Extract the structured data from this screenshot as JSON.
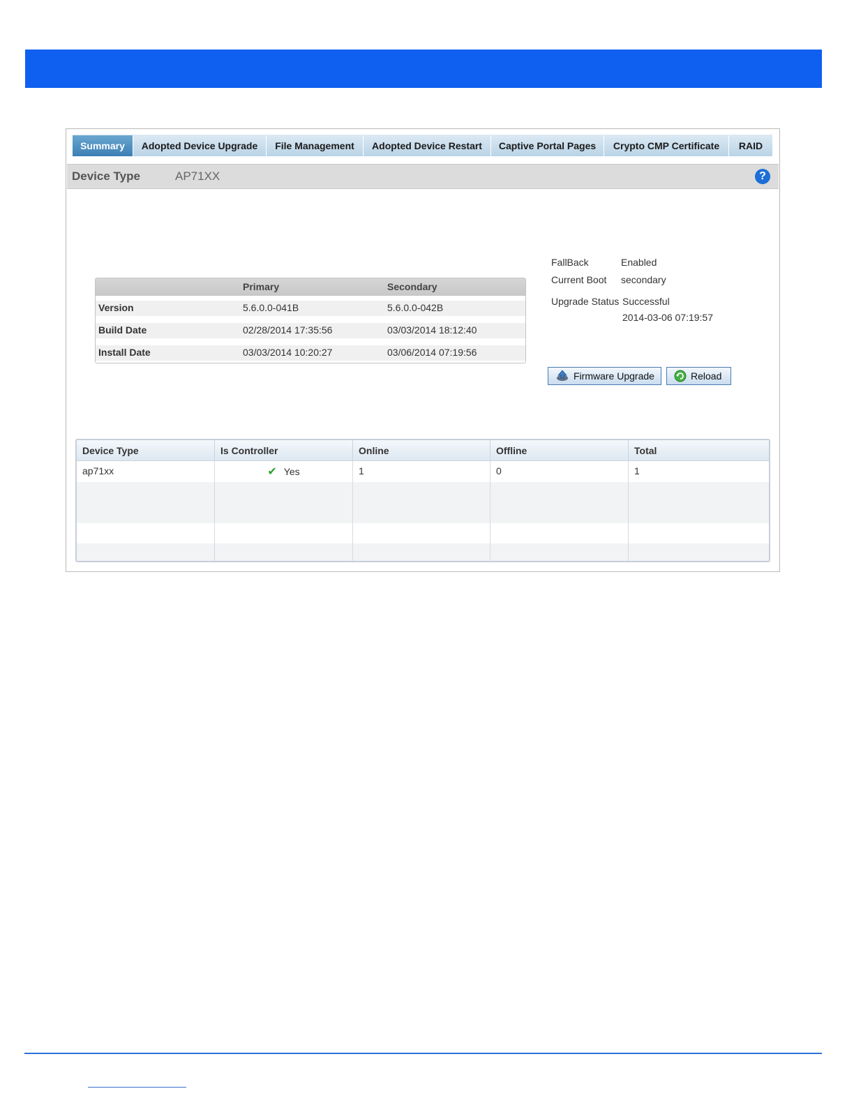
{
  "tabs": [
    {
      "label": "Summary",
      "active": true
    },
    {
      "label": "Adopted Device Upgrade",
      "active": false
    },
    {
      "label": "File Management",
      "active": false
    },
    {
      "label": "Adopted Device Restart",
      "active": false
    },
    {
      "label": "Captive Portal Pages",
      "active": false
    },
    {
      "label": "Crypto CMP Certificate",
      "active": false
    },
    {
      "label": "RAID",
      "active": false
    }
  ],
  "device_header": {
    "label": "Device Type",
    "value": "AP71XX",
    "help_icon": "question-circle-icon"
  },
  "version_table": {
    "headers": [
      "",
      "Primary",
      "Secondary"
    ],
    "rows": [
      {
        "label": "Version",
        "primary": "5.6.0.0-041B",
        "secondary": "5.6.0.0-042B"
      },
      {
        "label": "Build Date",
        "primary": "02/28/2014 17:35:56",
        "secondary": "03/03/2014 18:12:40"
      },
      {
        "label": "Install Date",
        "primary": "03/03/2014 10:20:27",
        "secondary": "03/06/2014 07:19:56"
      }
    ]
  },
  "status": {
    "fallback_label": "FallBack",
    "fallback_value": "Enabled",
    "current_boot_label": "Current Boot",
    "current_boot_value": "secondary",
    "upgrade_status_label": "Upgrade Status",
    "upgrade_status_value": "Successful",
    "upgrade_time": "2014-03-06 07:19:57"
  },
  "buttons": {
    "firmware_upgrade": "Firmware Upgrade",
    "reload": "Reload"
  },
  "device_table": {
    "headers": [
      "Device Type",
      "Is Controller",
      "Online",
      "Offline",
      "Total"
    ],
    "rows": [
      {
        "device_type": "ap71xx",
        "is_controller": "Yes",
        "online": "1",
        "offline": "0",
        "total": "1"
      }
    ]
  },
  "colors": {
    "banner": "#0f5ff0",
    "active_tab": "#3b7fb5",
    "help": "#1d6fd6",
    "check": "#2aa12a"
  }
}
